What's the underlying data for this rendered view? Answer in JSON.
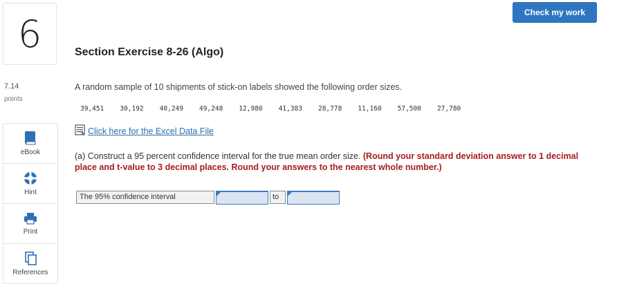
{
  "question": {
    "number": "6",
    "points_value": "7.14",
    "points_label": "points"
  },
  "header": {
    "check_button": "Check my work"
  },
  "tools": [
    {
      "label": "eBook",
      "icon": "book-icon"
    },
    {
      "label": "Hint",
      "icon": "lifebuoy-icon"
    },
    {
      "label": "Print",
      "icon": "printer-icon"
    },
    {
      "label": "References",
      "icon": "documents-icon"
    }
  ],
  "content": {
    "title": "Section Exercise 8-26 (Algo)",
    "prompt": "A random sample of 10 shipments of stick-on labels showed the following order sizes.",
    "data_values": [
      "39,451",
      "30,192",
      "40,249",
      "49,248",
      "12,980",
      "41,383",
      "28,778",
      "11,160",
      "57,500",
      "27,780"
    ],
    "excel_link": "Click here for the Excel Data File",
    "part_a": {
      "text": "(a) Construct a 95 percent confidence interval for the true mean order size.",
      "instruction": "(Round your standard deviation answer to 1 decimal place and t-value to 3 decimal places. Round your answers to the nearest whole number.)"
    },
    "ci": {
      "label": "The 95% confidence interval",
      "separator": "to",
      "lower_value": "",
      "upper_value": ""
    }
  },
  "colors": {
    "accent": "#2f76c2",
    "instruction_red": "#a51d1d",
    "input_fill": "#dbe4f2"
  }
}
